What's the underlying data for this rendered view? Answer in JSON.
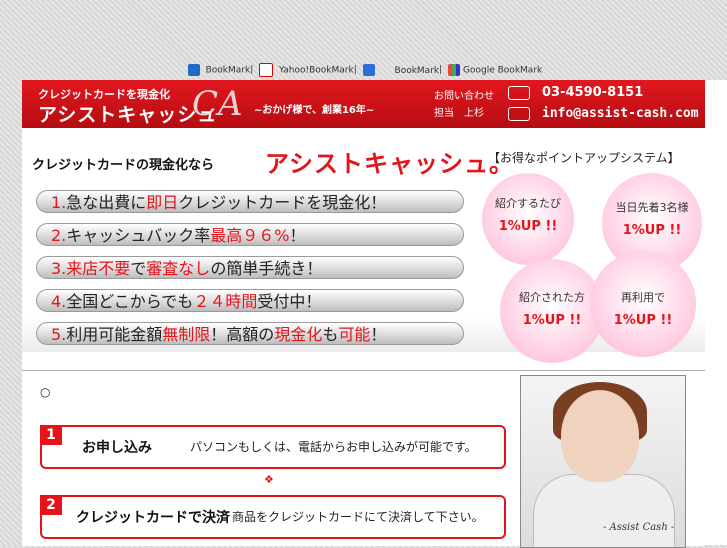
{
  "bookmarks": [
    {
      "icon": "hatena-icon",
      "label": "BookMark"
    },
    {
      "icon": "yahoo-icon",
      "label": "Yahoo!BookMark"
    },
    {
      "icon": "livedoor-icon",
      "label": "BookMark"
    },
    {
      "icon": "google-icon",
      "label": "Google BookMark"
    }
  ],
  "header": {
    "subtitle": "クレジットカードを現金化",
    "title": "アシストキャッシュ",
    "logo": "CA",
    "tagline": "~おかげ様で、創業16年~",
    "contact_label": "お問い合わせ",
    "staff_label": "担当　上杉",
    "phone": "03-4590-8151",
    "email": "info@assist-cash.com"
  },
  "hero": {
    "sub": "クレジットカードの現金化なら",
    "title": "アシストキャッシュ。",
    "features": [
      {
        "num": "1.",
        "a": "急な出費に",
        "red": "即日",
        "b": "クレジットカードを現金化！"
      },
      {
        "num": "2.",
        "a": "キャッシュバック率",
        "red": "最高９６%",
        "b": "！"
      },
      {
        "num": "3.",
        "a": "",
        "red": "来店不要",
        "b": "で",
        "red2": "審査なし",
        "c": "の簡単手続き！"
      },
      {
        "num": "4.",
        "a": "全国どこからでも",
        "red": "２４時間",
        "b": "受付中！"
      },
      {
        "num": "5.",
        "a": "利用可能金額",
        "red": "無制限",
        "b": "！高額の",
        "red2": "現金化",
        "c": "も",
        "red3": "可能",
        "d": "！"
      }
    ]
  },
  "points": {
    "heading": "【お得なポイントアップシステム】",
    "items": [
      {
        "label": "紹介するたび",
        "value": "1%UP !!"
      },
      {
        "label": "当日先着3名様",
        "value": "1%UP !!"
      },
      {
        "label": "紹介された方",
        "value": "1%UP !!"
      },
      {
        "label": "再利用で",
        "value": "1%UP !!"
      }
    ]
  },
  "content": {
    "bullet": "○",
    "steps": [
      {
        "num": "1",
        "title": "お申し込み",
        "desc": "パソコンもしくは、電話からお申し込みが可能です。"
      },
      {
        "num": "2",
        "title": "クレジットカードで決済",
        "desc": "商品をクレジットカードにて決済して下さい。"
      }
    ],
    "photo_caption": "- Assist Cash -"
  },
  "colors": {
    "accent": "#e4141b",
    "pink": "#ffb2d3"
  }
}
